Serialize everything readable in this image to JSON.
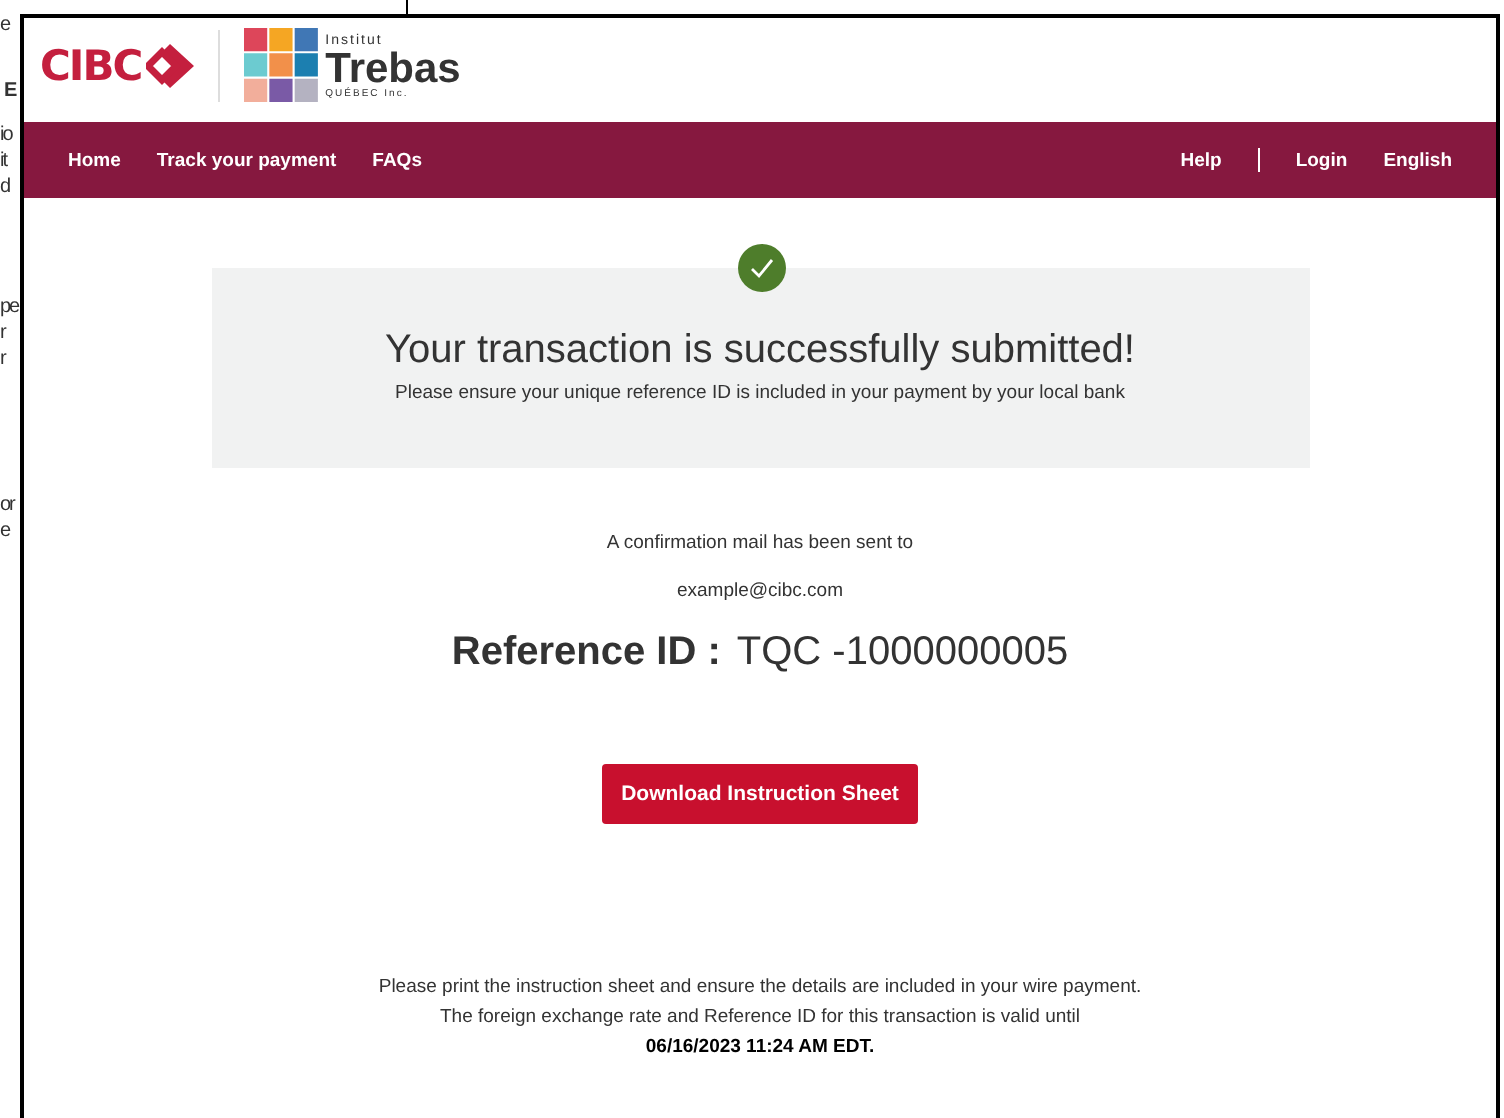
{
  "background_document": {
    "fragments": [
      "e",
      "E",
      "io",
      "it",
      "d",
      "pe",
      "r",
      "r",
      "or",
      "e"
    ]
  },
  "header": {
    "bank_logo": "CIBC",
    "school_logo": {
      "top": "Institut",
      "name": "Trebas",
      "bottom": "QUÉBEC Inc."
    }
  },
  "nav": {
    "left": [
      "Home",
      "Track your payment",
      "FAQs"
    ],
    "right": [
      "Help",
      "Login",
      "English"
    ]
  },
  "banner": {
    "title": "Your transaction is successfully submitted!",
    "subtitle": "Please ensure your unique reference ID is included in your payment by your local bank"
  },
  "confirmation": {
    "text": "A confirmation mail has been sent to",
    "email": "example@cibc.com"
  },
  "reference": {
    "label": "Reference ID :",
    "value": "TQC -1000000005"
  },
  "button": "Download Instruction Sheet",
  "notes": [
    "Please print the instruction sheet and ensure the details are included in your wire payment.",
    "The foreign exchange rate and Reference ID for this transaction is valid until",
    "06/16/2023 11:24 AM EDT."
  ]
}
